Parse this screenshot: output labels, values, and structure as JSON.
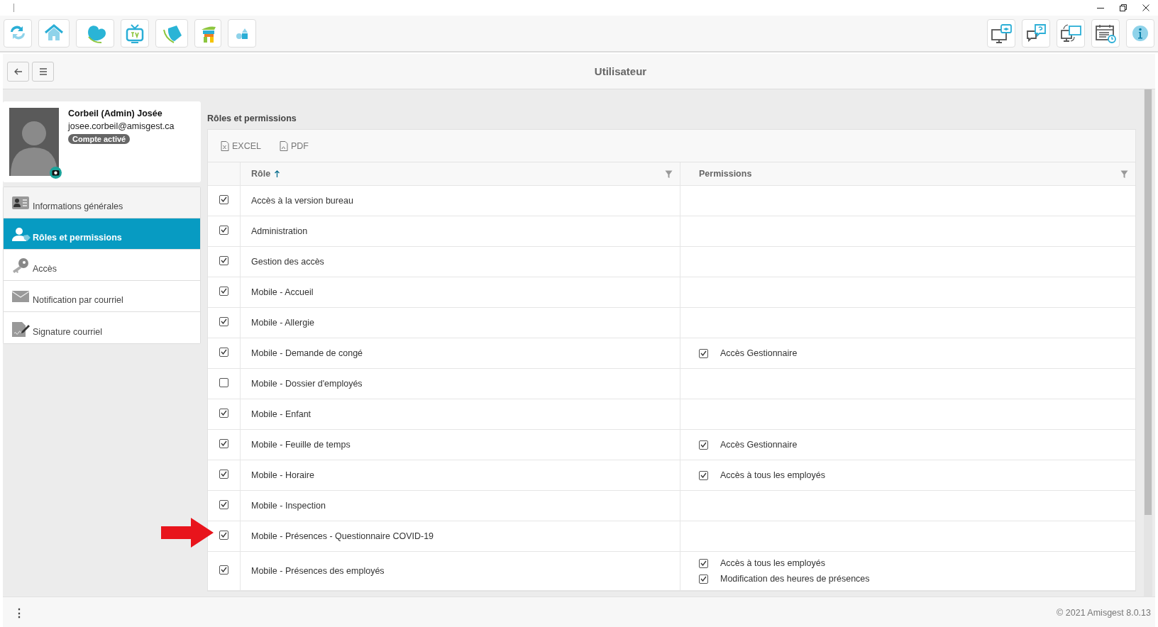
{
  "page_title": "Utilisateur",
  "profile": {
    "name": "Corbeil (Admin) Josée",
    "email": "josee.corbeil@amisgest.ca",
    "badge": "Compte activé"
  },
  "nav": [
    {
      "label": "Informations générales",
      "selected": false
    },
    {
      "label": "Rôles et permissions",
      "selected": true
    },
    {
      "label": "Accès",
      "selected": false
    },
    {
      "label": "Notification par courriel",
      "selected": false
    },
    {
      "label": "Signature courriel",
      "selected": false
    }
  ],
  "section_title": "Rôles et permissions",
  "export_buttons": [
    {
      "label": "EXCEL"
    },
    {
      "label": "PDF"
    }
  ],
  "table": {
    "columns": [
      {
        "label": "Rôle",
        "sorted": true
      },
      {
        "label": "Permissions"
      }
    ],
    "rows": [
      {
        "checked": true,
        "role": "Accès à la version bureau",
        "permissions": []
      },
      {
        "checked": true,
        "role": "Administration",
        "permissions": []
      },
      {
        "checked": true,
        "role": "Gestion des accès",
        "permissions": []
      },
      {
        "checked": true,
        "role": "Mobile - Accueil",
        "permissions": []
      },
      {
        "checked": true,
        "role": "Mobile - Allergie",
        "permissions": []
      },
      {
        "checked": true,
        "role": "Mobile - Demande de congé",
        "permissions": [
          {
            "label": "Accès Gestionnaire",
            "checked": true
          }
        ]
      },
      {
        "checked": false,
        "role": "Mobile - Dossier d'employés",
        "permissions": []
      },
      {
        "checked": true,
        "role": "Mobile - Enfant",
        "permissions": []
      },
      {
        "checked": true,
        "role": "Mobile - Feuille de temps",
        "permissions": [
          {
            "label": "Accès Gestionnaire",
            "checked": true
          }
        ]
      },
      {
        "checked": true,
        "role": "Mobile - Horaire",
        "permissions": [
          {
            "label": "Accès à tous les employés",
            "checked": true
          }
        ]
      },
      {
        "checked": true,
        "role": "Mobile - Inspection",
        "permissions": []
      },
      {
        "checked": true,
        "role": "Mobile - Présences - Questionnaire COVID-19",
        "permissions": []
      },
      {
        "checked": true,
        "role": "Mobile - Présences des employés",
        "permissions": [
          {
            "label": "Accès à tous les employés",
            "checked": true
          },
          {
            "label": "Modification des heures de présences",
            "checked": true
          }
        ]
      }
    ]
  },
  "footer": {
    "menu_glyph": "⋮",
    "copyright": "© 2021 Amisgest 8.0.13"
  }
}
